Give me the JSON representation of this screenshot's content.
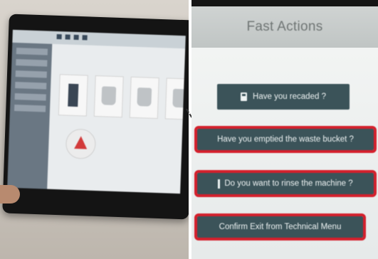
{
  "panel": {
    "title": "Fast Actions",
    "actions": [
      {
        "label": "Have you recaded ?",
        "icon": "fuel-pump-icon",
        "highlighted": false
      },
      {
        "label": "Have you emptied the waste bucket ?",
        "icon": "",
        "highlighted": true
      },
      {
        "label": "Do you want to rinse the machine ?",
        "icon": "power-icon",
        "highlighted": true
      },
      {
        "label": "Confirm Exit from Technical Menu",
        "icon": "",
        "highlighted": true
      }
    ],
    "colors": {
      "button": "#3b5359",
      "highlight": "#d4202c",
      "header": "#c6cbca"
    }
  },
  "photo": {
    "description_icons": [
      "machine-icon",
      "bucket-icon",
      "bucket-icon",
      "alert-triangle-icon"
    ]
  }
}
